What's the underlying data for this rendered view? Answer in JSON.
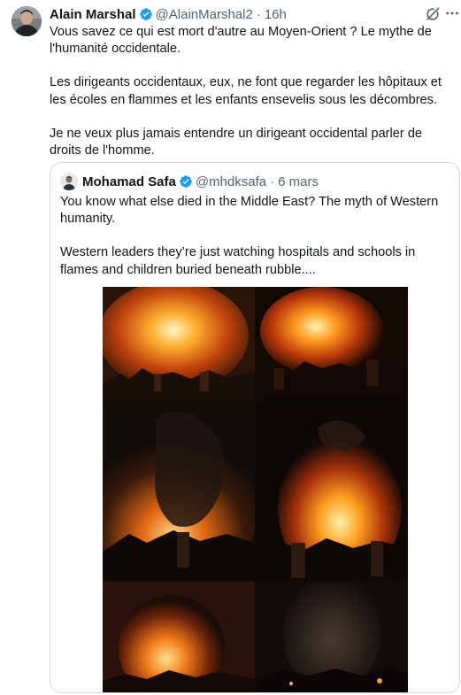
{
  "tweet": {
    "author_name": "Alain Marshal",
    "author_handle": "@AlainMarshal2",
    "separator": "·",
    "time": "16h",
    "paragraphs": [
      "Vous savez ce qui est mort d'autre au Moyen-Orient ? Le mythe de l'humanité occidentale.",
      "Les dirigeants occidentaux, eux, ne font que regarder les hôpitaux et les écoles en flammes et les enfants ensevelis sous les décombres.",
      "Je ne veux plus jamais entendre un dirigeant occidental parler de droits de l'homme."
    ]
  },
  "quoted": {
    "author_name": "Mohamad Safa",
    "author_handle": "@mhdksafa",
    "separator": "·",
    "time": "6 mars",
    "paragraphs": [
      "You know what else died in the Middle East? The myth of Western humanity.",
      "Western leaders they’re just watching hospitals and schools in flames and children buried beneath rubble...."
    ]
  },
  "icons": {
    "verified": "verified-badge-icon",
    "grok": "grok-icon",
    "more": "more-icon"
  },
  "colors": {
    "text": "#0f1419",
    "muted": "#536471",
    "verified": "#1d9bf0",
    "border": "#cfd9de"
  }
}
